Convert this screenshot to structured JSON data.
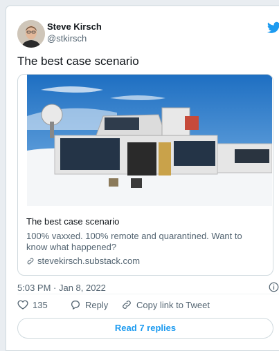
{
  "author": {
    "name": "Steve Kirsch",
    "handle": "@stkirsch"
  },
  "tweet": {
    "text": "The best case scenario"
  },
  "card": {
    "title": "The best case scenario",
    "description": "100% vaxxed. 100% remote and quarantined. Want to know what happened?",
    "domain": "stevekirsch.substack.com"
  },
  "meta": {
    "timestamp": "5:03 PM · Jan 8, 2022"
  },
  "actions": {
    "likes": "135",
    "reply_label": "Reply",
    "copy_label": "Copy link to Tweet"
  },
  "footer": {
    "read_replies": "Read 7 replies"
  },
  "colors": {
    "accent": "#1d9bf0",
    "secondary_text": "#536471",
    "border": "#cfd9de"
  },
  "icons": [
    "twitter-bird-icon",
    "link-icon",
    "info-icon",
    "heart-icon",
    "reply-icon",
    "copy-link-icon"
  ]
}
